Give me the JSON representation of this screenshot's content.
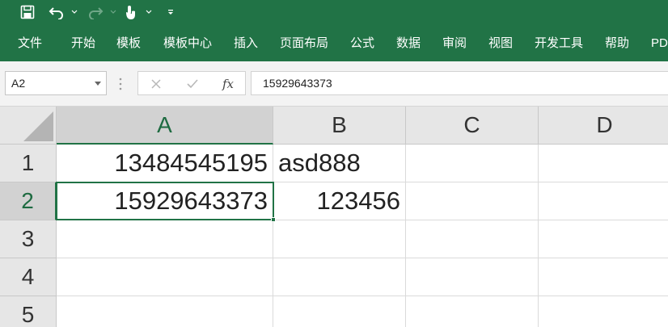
{
  "quick_access": {
    "icons": [
      "save-icon",
      "undo-icon",
      "redo-icon",
      "touch-mode-icon",
      "customize-icon"
    ]
  },
  "ribbon": {
    "tabs": [
      {
        "label": "文件"
      },
      {
        "label": "开始"
      },
      {
        "label": "模板"
      },
      {
        "label": "模板中心"
      },
      {
        "label": "插入"
      },
      {
        "label": "页面布局"
      },
      {
        "label": "公式"
      },
      {
        "label": "数据"
      },
      {
        "label": "审阅"
      },
      {
        "label": "视图"
      },
      {
        "label": "开发工具"
      },
      {
        "label": "帮助"
      },
      {
        "label": "PD"
      }
    ]
  },
  "formula_bar": {
    "name_box": "A2",
    "fx_label": "fx",
    "value": "15929643373"
  },
  "sheet": {
    "columns": [
      "A",
      "B",
      "C",
      "D"
    ],
    "rows": [
      "1",
      "2",
      "3",
      "4",
      "5"
    ],
    "selected_cell": "A2",
    "cells": {
      "A1": "13484545195",
      "B1": "asd888",
      "A2": "15929643373",
      "B2": "123456"
    }
  },
  "colors": {
    "accent": "#217346",
    "header_bg": "#e6e6e6",
    "header_selected_bg": "#d2d2d2"
  }
}
